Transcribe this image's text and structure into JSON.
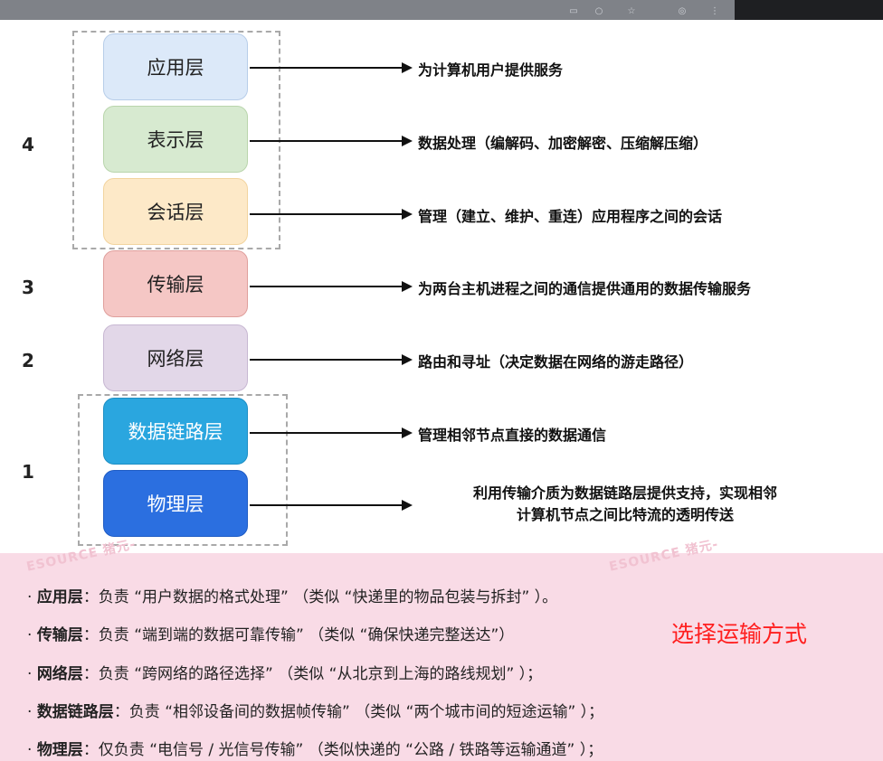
{
  "layers": [
    {
      "name": "应用层",
      "desc": "为计算机用户提供服务",
      "color": "#dce9f9",
      "border": "#b7cde9",
      "text": "#222222"
    },
    {
      "name": "表示层",
      "desc": "数据处理（编解码、加密解密、压缩解压缩）",
      "color": "#d7ead0",
      "border": "#b9d5ac",
      "text": "#222222"
    },
    {
      "name": "会话层",
      "desc": "管理（建立、维护、重连）应用程序之间的会话",
      "color": "#fde9c8",
      "border": "#f2d49f",
      "text": "#222222"
    },
    {
      "name": "传输层",
      "desc": "为两台主机进程之间的通信提供通用的数据传输服务",
      "color": "#f5c7c5",
      "border": "#df9f9c",
      "text": "#222222"
    },
    {
      "name": "网络层",
      "desc": "路由和寻址（决定数据在网络的游走路径）",
      "color": "#e2d7e8",
      "border": "#c7b7d2",
      "text": "#222222"
    },
    {
      "name": "数据链路层",
      "desc": "管理相邻节点直接的数据通信",
      "color": "#2aa6df",
      "border": "#1d8fc4",
      "text": "#ffffff"
    },
    {
      "name": "物理层",
      "desc_line1": "利用传输介质为数据链路层提供支持，实现相邻",
      "desc_line2": "计算机节点之间比特流的透明传送",
      "color": "#2b6fe0",
      "border": "#1f5cc4",
      "text": "#ffffff"
    }
  ],
  "group_numbers": [
    "4",
    "3",
    "2",
    "1"
  ],
  "notes": [
    {
      "term": "应用层",
      "text": "：负责 “用户数据的格式处理” （类似 “快递里的物品包装与拆封” ）。"
    },
    {
      "term": "传输层",
      "text": "：负责 “端到端的数据可靠传输” （类似 “确保快递完整送达”）"
    },
    {
      "term": "网络层",
      "text": "：负责 “跨网络的路径选择” （类似 “从北京到上海的路线规划” ）；"
    },
    {
      "term": "数据链路层",
      "text": "：负责 “相邻设备间的数据帧传输” （类似 “两个城市间的短途运输” ）；"
    },
    {
      "term": "物理层",
      "text": "：仅负责 “电信号 / 光信号传输” （类似快递的 “公路 / 铁路等运输通道” ）；"
    }
  ],
  "red_note": "选择运输方式",
  "watermarks": [
    "ESOURCE 猪元-",
    "ESOURCE 猪元-"
  ],
  "colors": {
    "pink_panel": "#f9dbe6",
    "red_note": "#ff1f1f",
    "topbar": "#7f8288"
  }
}
